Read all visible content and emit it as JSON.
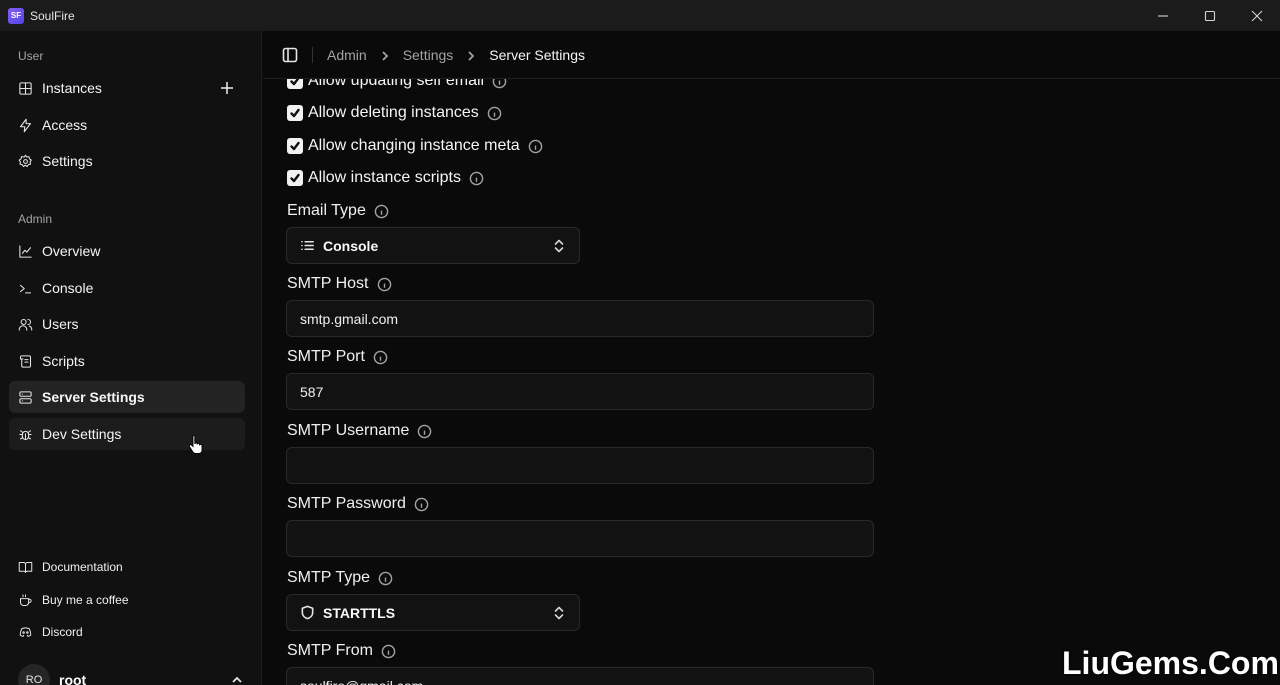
{
  "window": {
    "logo_text": "SF",
    "title": "SoulFire"
  },
  "sidebar": {
    "user_group_label": "User",
    "user_items": [
      {
        "label": "Instances",
        "icon": "grid-icon"
      },
      {
        "label": "Access",
        "icon": "zap-icon"
      },
      {
        "label": "Settings",
        "icon": "gear-icon"
      }
    ],
    "admin_group_label": "Admin",
    "admin_items": [
      {
        "label": "Overview",
        "icon": "chart-icon"
      },
      {
        "label": "Console",
        "icon": "terminal-icon"
      },
      {
        "label": "Users",
        "icon": "users-icon"
      },
      {
        "label": "Scripts",
        "icon": "scroll-icon"
      },
      {
        "label": "Server Settings",
        "icon": "server-icon",
        "active": true
      },
      {
        "label": "Dev Settings",
        "icon": "bug-icon"
      }
    ],
    "footer_items": [
      {
        "label": "Documentation",
        "icon": "book-icon"
      },
      {
        "label": "Buy me a coffee",
        "icon": "coffee-icon"
      },
      {
        "label": "Discord",
        "icon": "discord-icon"
      }
    ],
    "user": {
      "initials": "RO",
      "name": "root"
    }
  },
  "header": {
    "breadcrumbs": [
      "Admin",
      "Settings",
      "Server Settings"
    ]
  },
  "main": {
    "checkboxes": [
      {
        "label": "Allow updating self email",
        "checked": true
      },
      {
        "label": "Allow deleting instances",
        "checked": true
      },
      {
        "label": "Allow changing instance meta",
        "checked": true
      },
      {
        "label": "Allow instance scripts",
        "checked": true
      }
    ],
    "email_type": {
      "label": "Email Type",
      "value": "Console",
      "icon": "list-icon"
    },
    "smtp_host": {
      "label": "SMTP Host",
      "value": "smtp.gmail.com"
    },
    "smtp_port": {
      "label": "SMTP Port",
      "value": "587"
    },
    "smtp_username": {
      "label": "SMTP Username",
      "value": ""
    },
    "smtp_password": {
      "label": "SMTP Password",
      "value": ""
    },
    "smtp_type": {
      "label": "SMTP Type",
      "value": "STARTTLS",
      "icon": "shield-icon"
    },
    "smtp_from": {
      "label": "SMTP From",
      "value": "soulfire@gmail.com"
    }
  },
  "watermark": "LiuGems.Com",
  "colors": {
    "background": "#0a0a0a",
    "sidebar": "#111111",
    "active_item": "#232323"
  }
}
